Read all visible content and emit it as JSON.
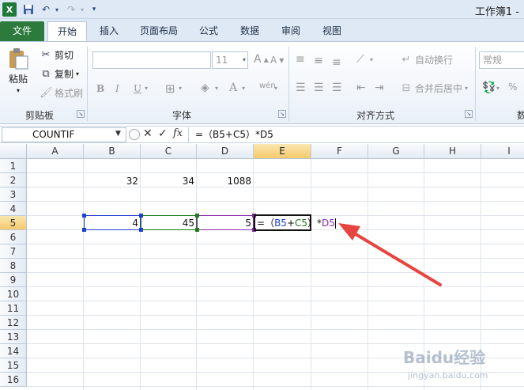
{
  "titlebar": {
    "window_title": "工作簿1 -",
    "logo": "X",
    "icons": [
      "excel-icon",
      "save-icon",
      "undo-icon",
      "redo-icon",
      "customize-qa-icon"
    ]
  },
  "tabs": [
    {
      "label": "文件",
      "active": false
    },
    {
      "label": "开始",
      "active": true
    },
    {
      "label": "插入",
      "active": false
    },
    {
      "label": "页面布局",
      "active": false
    },
    {
      "label": "公式",
      "active": false
    },
    {
      "label": "数据",
      "active": false
    },
    {
      "label": "审阅",
      "active": false
    },
    {
      "label": "视图",
      "active": false
    }
  ],
  "ribbon": {
    "clipboard": {
      "paste": "粘贴",
      "cut": "剪切",
      "copy": "复制",
      "format_painter": "格式刷",
      "label": "剪贴板"
    },
    "font": {
      "font_name": "",
      "font_size": "11",
      "bold": "B",
      "italic": "I",
      "underline": "U",
      "grow": "A",
      "shrink": "A",
      "font_color": "A",
      "phonetic": "wén",
      "label": "字体"
    },
    "alignment": {
      "wrap_text": "自动换行",
      "merge_center": "合并后居中",
      "label": "对齐方式"
    },
    "number": {
      "format": "常规",
      "percent": "%",
      "label": "数"
    }
  },
  "formula_bar": {
    "name_box": "COUNTIF",
    "formula": "=（B5+C5）*D5",
    "fx": "fx"
  },
  "grid": {
    "columns": [
      "A",
      "B",
      "C",
      "D",
      "E",
      "F",
      "G",
      "H",
      "I"
    ],
    "active_column": "E",
    "rows": [
      "1",
      "2",
      "3",
      "4",
      "5",
      "6",
      "7",
      "8",
      "9",
      "10",
      "11",
      "12",
      "13",
      "14",
      "15",
      "16"
    ],
    "active_row": "5",
    "cells": {
      "B2": "32",
      "C2": "34",
      "D2": "1088",
      "B5": "4",
      "C5": "45",
      "D5": "5"
    },
    "editing_cell": {
      "ref": "E5",
      "eq": "=",
      "open_paren": "（",
      "ref1": "B5",
      "plus": "+",
      "ref2": "C5",
      "close_paren": "）",
      "times": "*",
      "ref3": "D5"
    },
    "ref_colors": {
      "B5": "#1f3fd1",
      "C5": "#1e7a1e",
      "D5": "#8a2aa8"
    }
  },
  "watermark": {
    "text": "Baidu经验",
    "url": "jingyan.baidu.com"
  }
}
